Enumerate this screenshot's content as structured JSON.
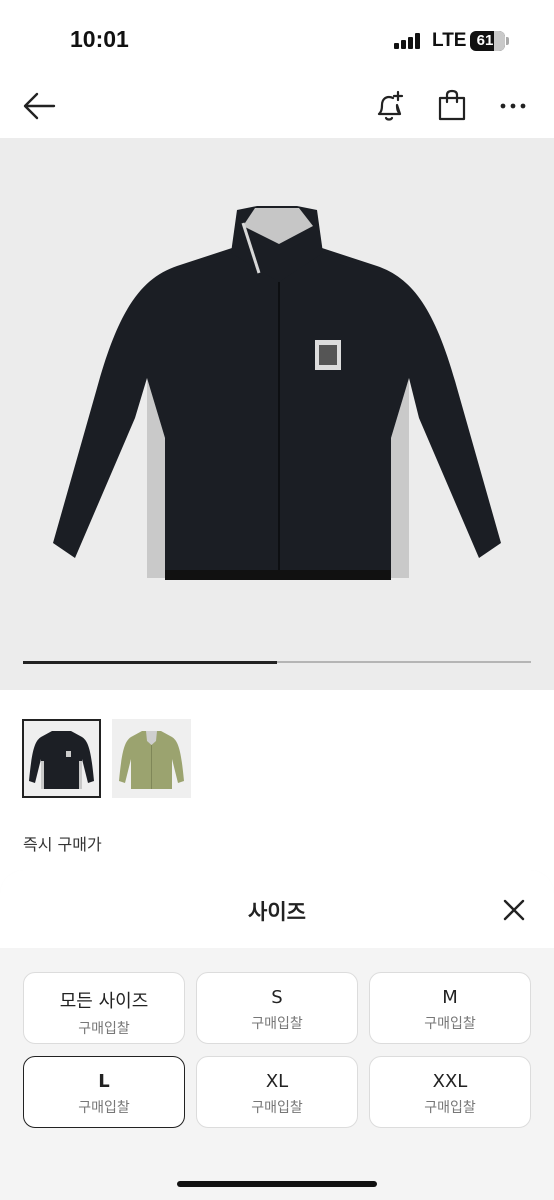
{
  "status_bar": {
    "time": "10:01",
    "network": "LTE",
    "battery": "61"
  },
  "nav": {
    "back_icon": "arrow-left-icon",
    "alert_icon": "bell-plus-icon",
    "bag_icon": "shopping-bag-icon",
    "more_icon": "more-horizontal-icon"
  },
  "gallery": {
    "progress": 0.5,
    "thumbnails": [
      {
        "name": "black-jacket",
        "color": "#1c1f25",
        "selected": true
      },
      {
        "name": "olive-jacket",
        "color": "#9ba36f",
        "selected": false
      }
    ]
  },
  "instant_price_label": "즉시 구매가",
  "size_sheet": {
    "title": "사이즈",
    "close_icon": "close-icon",
    "options": [
      {
        "label": "모든 사이즈",
        "sub": "구매입찰",
        "selected": false
      },
      {
        "label": "S",
        "sub": "구매입찰",
        "selected": false
      },
      {
        "label": "M",
        "sub": "구매입찰",
        "selected": false
      },
      {
        "label": "L",
        "sub": "구매입찰",
        "selected": true
      },
      {
        "label": "XL",
        "sub": "구매입찰",
        "selected": false
      },
      {
        "label": "XXL",
        "sub": "구매입찰",
        "selected": false
      }
    ]
  },
  "colors": {
    "image_bg": "#ececec",
    "sheet_bg": "#f4f4f4",
    "selected_border": "#222222"
  }
}
